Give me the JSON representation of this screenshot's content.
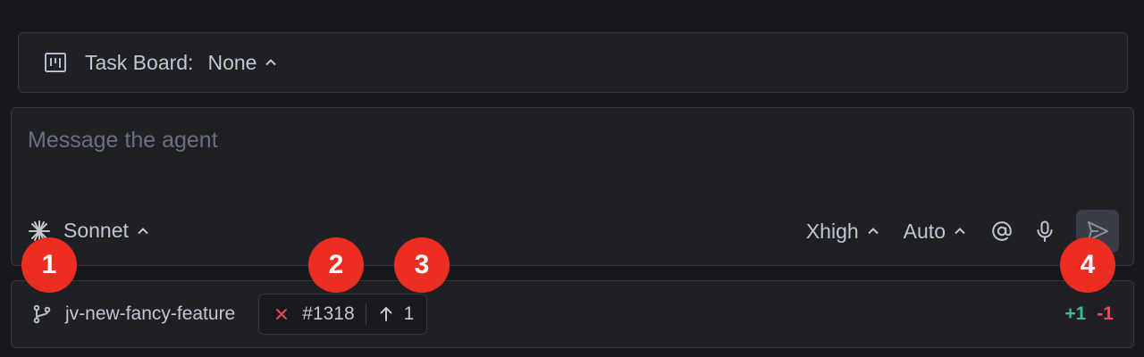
{
  "task_board": {
    "label": "Task Board:",
    "value": "None",
    "icon": "kanban-board-icon"
  },
  "composer": {
    "placeholder": "Message the agent",
    "model": {
      "label": "Sonnet",
      "icon": "sparkle-icon"
    },
    "effort": {
      "label": "Xhigh"
    },
    "mode": {
      "label": "Auto"
    },
    "mention_icon": "at-sign-icon",
    "mic_icon": "microphone-icon",
    "send_icon": "send-icon"
  },
  "branch_bar": {
    "branch_icon": "git-branch-icon",
    "branch_name": "jv-new-fancy-feature",
    "pr": {
      "status_icon": "x-icon",
      "status_color": "#f0475a",
      "number": "#1318",
      "push_icon": "arrow-up-icon",
      "ahead_count": "1"
    },
    "diff": {
      "added": "+1",
      "removed": "-1",
      "added_color": "#3fb98d",
      "removed_color": "#f0475a"
    }
  },
  "callouts": [
    "1",
    "2",
    "3",
    "4"
  ],
  "colors": {
    "background": "#17181c",
    "panel": "#1e2026",
    "border": "#34373f",
    "callout": "#ed2d1f"
  }
}
